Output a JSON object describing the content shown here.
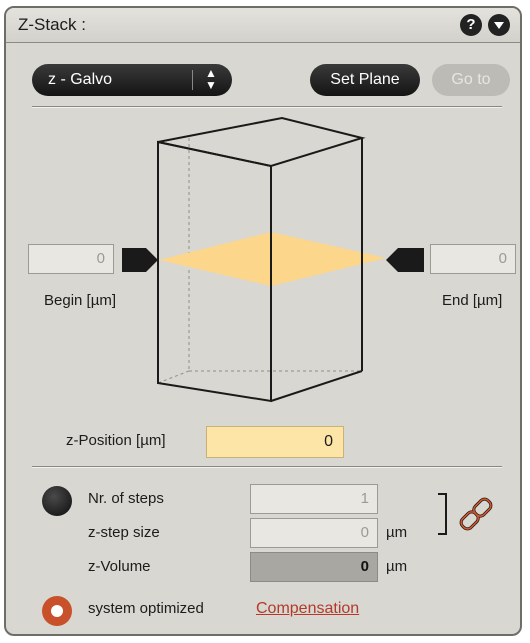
{
  "header": {
    "title": "Z-Stack :",
    "help_icon": "?",
    "collapse_icon": "chevron-down"
  },
  "toolbar": {
    "mode_select": "z - Galvo",
    "set_plane": "Set Plane",
    "go_to": "Go to"
  },
  "cube": {
    "begin_value": "0",
    "begin_label": "Begin [µm]",
    "end_value": "0",
    "end_label": "End [µm]",
    "plane_color": "#fcd68a"
  },
  "z_position": {
    "label": "z-Position [µm]",
    "value": "0"
  },
  "stack": {
    "steps_label": "Nr. of steps",
    "steps_value": "1",
    "step_size_label": "z-step size",
    "step_size_value": "0",
    "step_size_unit": "µm",
    "volume_label": "z-Volume",
    "volume_value": "0",
    "volume_unit": "µm"
  },
  "optimized": {
    "label": "system optimized",
    "link": "Compensation"
  },
  "colors": {
    "accent": "#c8502a",
    "link": "#b33a2a",
    "panel": "#d9d7d1"
  }
}
